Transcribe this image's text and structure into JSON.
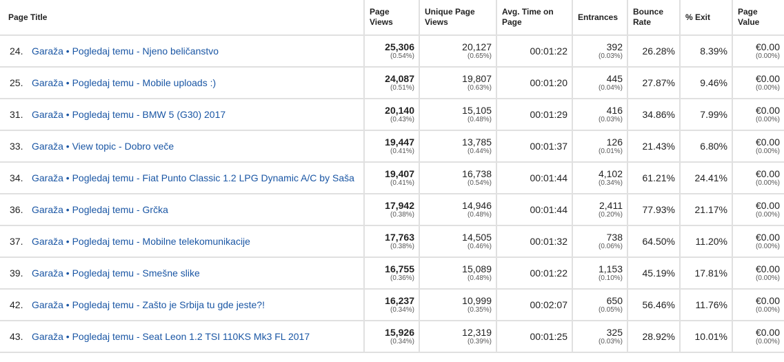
{
  "headers": {
    "page_title": "Page Title",
    "page_views": "Page Views",
    "unique_page_views": "Unique Page Views",
    "avg_time": "Avg. Time on Page",
    "entrances": "Entrances",
    "bounce_rate": "Bounce Rate",
    "exit": "% Exit",
    "page_value": "Page Value"
  },
  "rows": [
    {
      "rank": "24.",
      "title": "Garaža • Pogledaj temu - Njeno beličanstvo",
      "pv": "25,306",
      "pv_pct": "(0.54%)",
      "upv": "20,127",
      "upv_pct": "(0.65%)",
      "avg_time": "00:01:22",
      "ent": "392",
      "ent_pct": "(0.03%)",
      "bounce": "26.28%",
      "exit": "8.39%",
      "value": "€0.00",
      "value_pct": "(0.00%)"
    },
    {
      "rank": "25.",
      "title": "Garaža • Pogledaj temu - Mobile uploads :)",
      "pv": "24,087",
      "pv_pct": "(0.51%)",
      "upv": "19,807",
      "upv_pct": "(0.63%)",
      "avg_time": "00:01:20",
      "ent": "445",
      "ent_pct": "(0.04%)",
      "bounce": "27.87%",
      "exit": "9.46%",
      "value": "€0.00",
      "value_pct": "(0.00%)"
    },
    {
      "rank": "31.",
      "title": "Garaža • Pogledaj temu - BMW 5 (G30) 2017",
      "pv": "20,140",
      "pv_pct": "(0.43%)",
      "upv": "15,105",
      "upv_pct": "(0.48%)",
      "avg_time": "00:01:29",
      "ent": "416",
      "ent_pct": "(0.03%)",
      "bounce": "34.86%",
      "exit": "7.99%",
      "value": "€0.00",
      "value_pct": "(0.00%)"
    },
    {
      "rank": "33.",
      "title": "Garaža • View topic - Dobro veče",
      "pv": "19,447",
      "pv_pct": "(0.41%)",
      "upv": "13,785",
      "upv_pct": "(0.44%)",
      "avg_time": "00:01:37",
      "ent": "126",
      "ent_pct": "(0.01%)",
      "bounce": "21.43%",
      "exit": "6.80%",
      "value": "€0.00",
      "value_pct": "(0.00%)"
    },
    {
      "rank": "34.",
      "title": "Garaža • Pogledaj temu - Fiat Punto Classic 1.2 LPG Dynamic A/C by Saša",
      "pv": "19,407",
      "pv_pct": "(0.41%)",
      "upv": "16,738",
      "upv_pct": "(0.54%)",
      "avg_time": "00:01:44",
      "ent": "4,102",
      "ent_pct": "(0.34%)",
      "bounce": "61.21%",
      "exit": "24.41%",
      "value": "€0.00",
      "value_pct": "(0.00%)"
    },
    {
      "rank": "36.",
      "title": "Garaža • Pogledaj temu - Grčka",
      "pv": "17,942",
      "pv_pct": "(0.38%)",
      "upv": "14,946",
      "upv_pct": "(0.48%)",
      "avg_time": "00:01:44",
      "ent": "2,411",
      "ent_pct": "(0.20%)",
      "bounce": "77.93%",
      "exit": "21.17%",
      "value": "€0.00",
      "value_pct": "(0.00%)"
    },
    {
      "rank": "37.",
      "title": "Garaža • Pogledaj temu - Mobilne telekomunikacije",
      "pv": "17,763",
      "pv_pct": "(0.38%)",
      "upv": "14,505",
      "upv_pct": "(0.46%)",
      "avg_time": "00:01:32",
      "ent": "738",
      "ent_pct": "(0.06%)",
      "bounce": "64.50%",
      "exit": "11.20%",
      "value": "€0.00",
      "value_pct": "(0.00%)"
    },
    {
      "rank": "39.",
      "title": "Garaža • Pogledaj temu - Smešne slike",
      "pv": "16,755",
      "pv_pct": "(0.36%)",
      "upv": "15,089",
      "upv_pct": "(0.48%)",
      "avg_time": "00:01:22",
      "ent": "1,153",
      "ent_pct": "(0.10%)",
      "bounce": "45.19%",
      "exit": "17.81%",
      "value": "€0.00",
      "value_pct": "(0.00%)"
    },
    {
      "rank": "42.",
      "title": "Garaža • Pogledaj temu - Zašto je Srbija tu gde jeste?!",
      "pv": "16,237",
      "pv_pct": "(0.34%)",
      "upv": "10,999",
      "upv_pct": "(0.35%)",
      "avg_time": "00:02:07",
      "ent": "650",
      "ent_pct": "(0.05%)",
      "bounce": "56.46%",
      "exit": "11.76%",
      "value": "€0.00",
      "value_pct": "(0.00%)"
    },
    {
      "rank": "43.",
      "title": "Garaža • Pogledaj temu - Seat Leon 1.2 TSI 110KS Mk3 FL 2017",
      "pv": "15,926",
      "pv_pct": "(0.34%)",
      "upv": "12,319",
      "upv_pct": "(0.39%)",
      "avg_time": "00:01:25",
      "ent": "325",
      "ent_pct": "(0.03%)",
      "bounce": "28.92%",
      "exit": "10.01%",
      "value": "€0.00",
      "value_pct": "(0.00%)"
    }
  ],
  "colors": {
    "link": "#1a56a4",
    "grid": "#e0e0e0"
  }
}
